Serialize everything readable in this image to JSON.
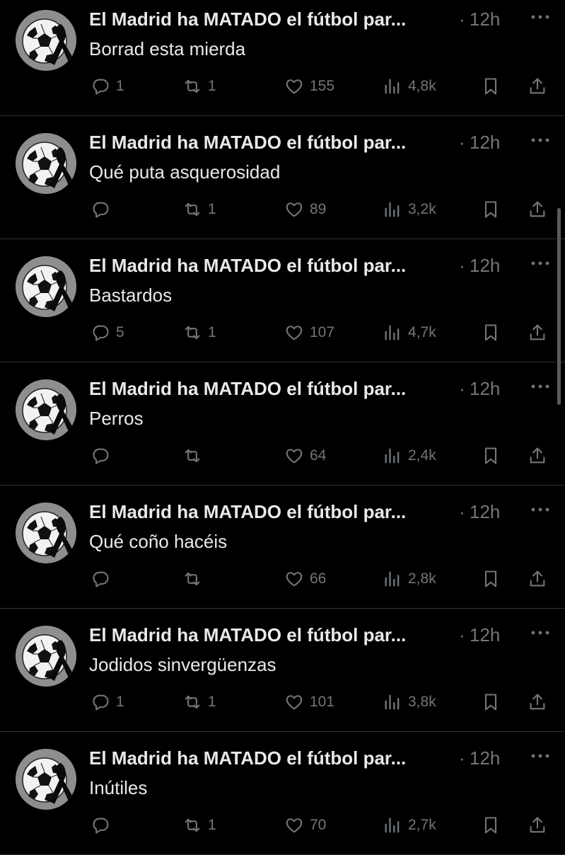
{
  "author": {
    "name": "El Madrid ha MATADO el fútbol par...",
    "avatar_icon": "soccer-ball-black-ribbon-icon"
  },
  "separator": "·",
  "icons": {
    "reply": "reply-icon",
    "retweet": "retweet-icon",
    "like": "heart-icon",
    "views": "views-icon",
    "bookmark": "bookmark-icon",
    "share": "share-icon",
    "more": "more-icon"
  },
  "colors": {
    "background": "#000000",
    "text": "#e7e9ea",
    "muted": "#71767b",
    "divider": "#2f3336"
  },
  "tweets": [
    {
      "time": "12h",
      "text": "Borrad esta mierda",
      "replies": "1",
      "retweets": "1",
      "likes": "155",
      "views": "4,8k"
    },
    {
      "time": "12h",
      "text": "Qué puta asquerosidad",
      "replies": "",
      "retweets": "1",
      "likes": "89",
      "views": "3,2k"
    },
    {
      "time": "12h",
      "text": "Bastardos",
      "replies": "5",
      "retweets": "1",
      "likes": "107",
      "views": "4,7k"
    },
    {
      "time": "12h",
      "text": "Perros",
      "replies": "",
      "retweets": "",
      "likes": "64",
      "views": "2,4k"
    },
    {
      "time": "12h",
      "text": "Qué coño hacéis",
      "replies": "",
      "retweets": "",
      "likes": "66",
      "views": "2,8k"
    },
    {
      "time": "12h",
      "text": "Jodidos sinvergüenzas",
      "replies": "1",
      "retweets": "1",
      "likes": "101",
      "views": "3,8k"
    },
    {
      "time": "12h",
      "text": "Inútiles",
      "replies": "",
      "retweets": "1",
      "likes": "70",
      "views": "2,7k"
    }
  ]
}
